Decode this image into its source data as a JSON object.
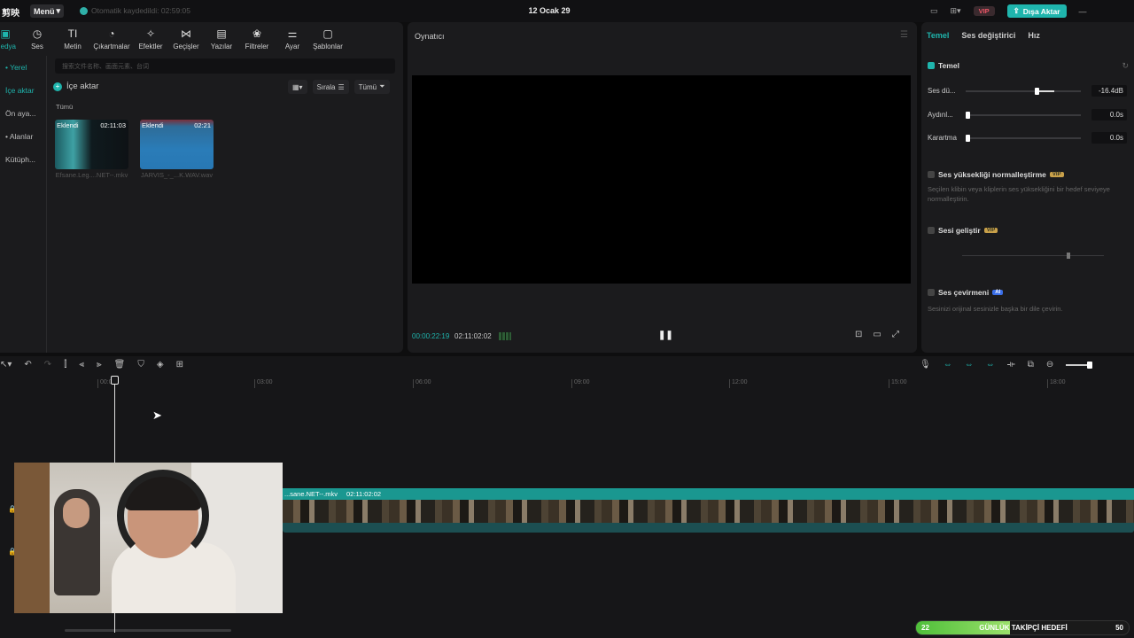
{
  "titlebar": {
    "logo": "剪映",
    "menu_label": "Menü",
    "autosave": "Otomatik kaydedildi: 02:59:05",
    "doc_title": "12 Ocak 29",
    "vip": "VIP",
    "export_label": "Dışa Aktar"
  },
  "tools": [
    {
      "label": "Medya",
      "icon": "media-icon",
      "glyph": "▣"
    },
    {
      "label": "Ses",
      "icon": "audio-icon",
      "glyph": "◷"
    },
    {
      "label": "Metin",
      "icon": "text-icon",
      "glyph": "TI"
    },
    {
      "label": "Çıkartmalar",
      "icon": "sticker-icon",
      "glyph": "◔"
    },
    {
      "label": "Efektler",
      "icon": "effects-icon",
      "glyph": "✧"
    },
    {
      "label": "Geçişler",
      "icon": "transition-icon",
      "glyph": "⋈"
    },
    {
      "label": "Yazılar",
      "icon": "captions-icon",
      "glyph": "▤"
    },
    {
      "label": "Filtreler",
      "icon": "filter-icon",
      "glyph": "❀"
    },
    {
      "label": "Ayar",
      "icon": "adjust-icon",
      "glyph": "⚌"
    },
    {
      "label": "Şablonlar",
      "icon": "template-icon",
      "glyph": "▢"
    }
  ],
  "sidenav": [
    "• Yerel",
    "İçe aktar",
    "Ön aya...",
    "• Alanlar",
    "Kütüph..."
  ],
  "search_placeholder": "搜索文件名称、画面元素、台词",
  "import_label": "İçe aktar",
  "view": {
    "sort": "Sırala",
    "filter": "Tümü"
  },
  "all_label": "Tümü",
  "media": [
    {
      "badge": "Eklendi",
      "duration": "02:11:03",
      "name": "Efsane.Leg....NET--.mkv"
    },
    {
      "badge": "Eklendi",
      "duration": "02:21",
      "name": "JARVIS_-_...K.WAV.wav"
    }
  ],
  "player": {
    "title": "Oynatıcı",
    "current_time": "00:00:22:19",
    "total_time": "02:11:02:02"
  },
  "right_panel": {
    "tabs": [
      "Temel",
      "Ses değiştirici",
      "Hız"
    ],
    "section": "Temel",
    "sliders": [
      {
        "label": "Ses dü...",
        "value": "-16.4dB",
        "level": 0.6
      },
      {
        "label": "Aydınl...",
        "value": "0.0s",
        "level": 0.0
      },
      {
        "label": "Karartma",
        "value": "0.0s",
        "level": 0.0
      }
    ],
    "normalize": {
      "label": "Ses yüksekliği normalleştirme",
      "tag": "VIP",
      "desc": "Seçilen klibin veya kliplerin ses yüksekliğini bir hedef seviyeye normalleştirin."
    },
    "enhance": {
      "label": "Sesi geliştir",
      "tag": "VIP"
    },
    "translate": {
      "label": "Ses çevirmeni",
      "tag": "AI",
      "desc": "Sesinizi orijinal sesinizle başka bir dile çevirin."
    }
  },
  "timeline": {
    "ticks": [
      "00:00",
      "03:00",
      "06:00",
      "09:00",
      "12:00",
      "15:00",
      "18:00"
    ],
    "clip_name": "...sane.NET--.mkv",
    "clip_duration": "02:11:02:02"
  },
  "follower_goal": {
    "current": "22",
    "label": "GÜNLÜK TAKİPÇİ HEDEFİ",
    "target": "50",
    "progress": 0.44
  }
}
